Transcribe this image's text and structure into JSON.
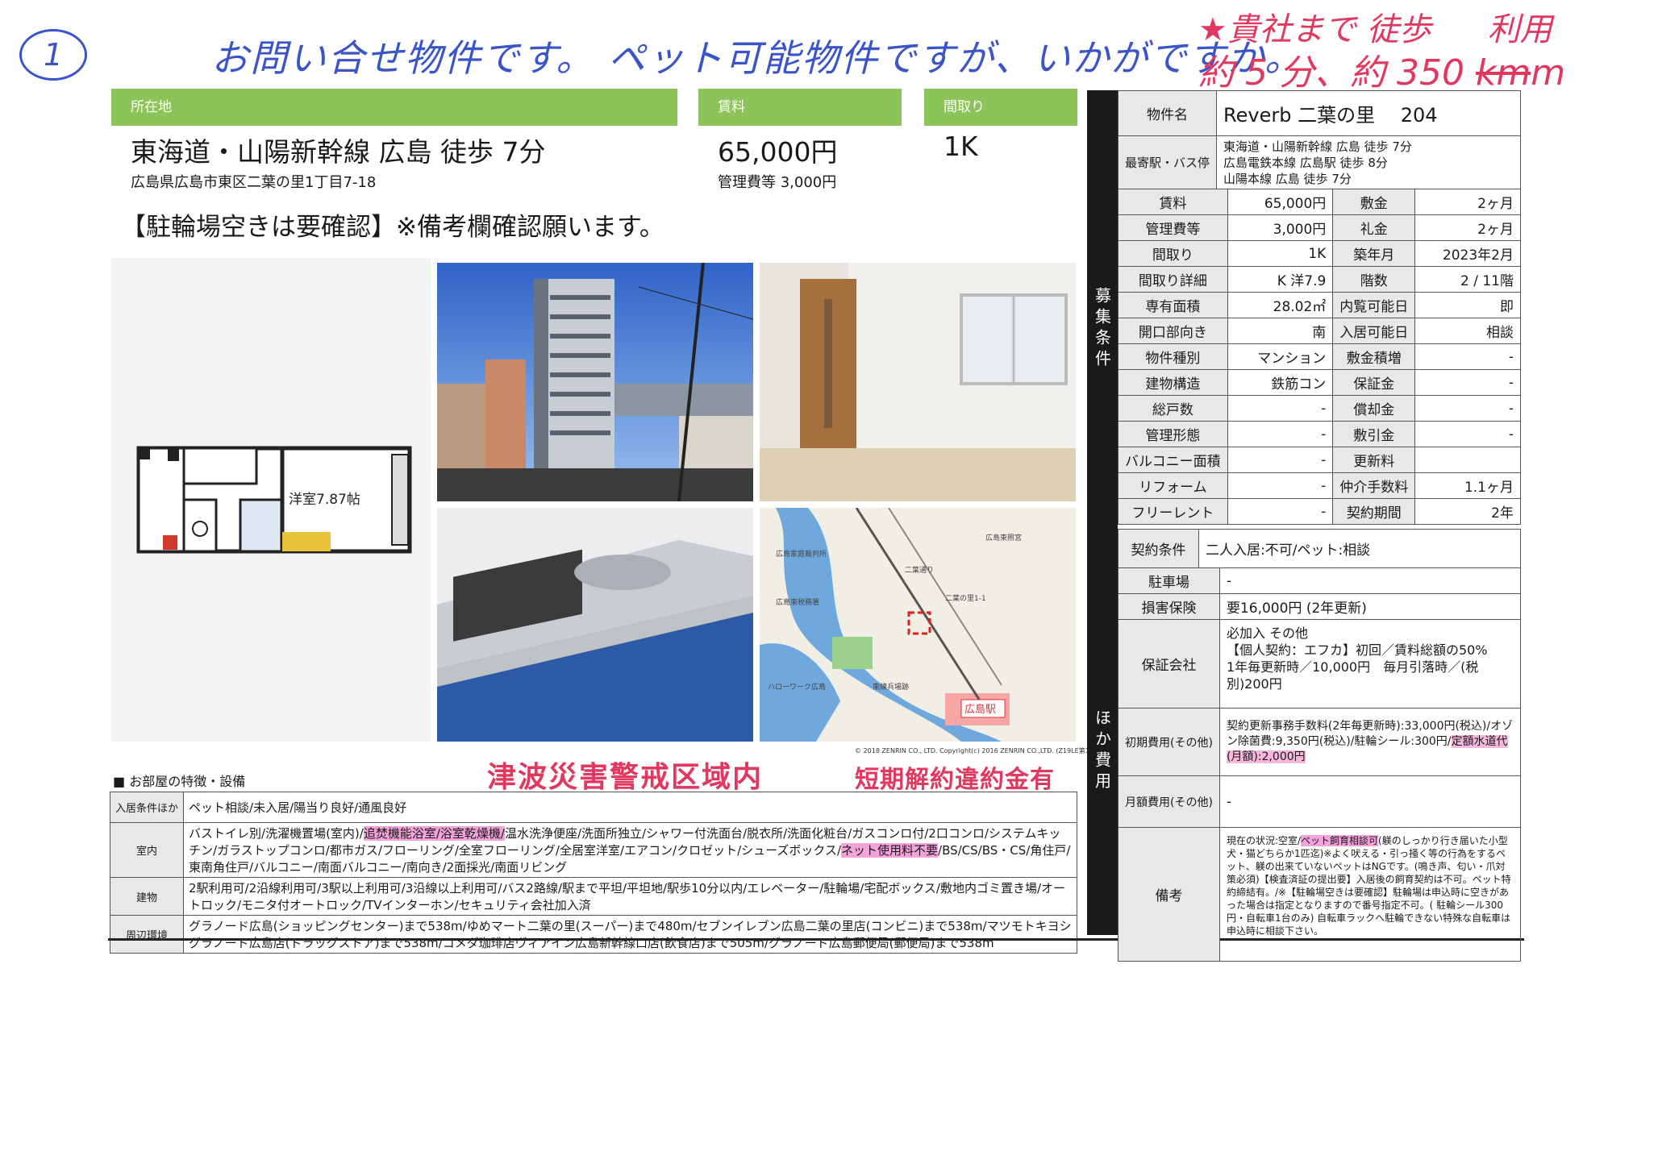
{
  "annotations": {
    "circle_number": "1",
    "blue_note": "お問い合せ物件です。 ペット可能物件ですが、いかがですか。",
    "red_line1_star": "★",
    "red_line1": "貴社まで 徒歩",
    "red_line1_right": "利用",
    "red_line2": "約 5 分、約 350",
    "red_km_struck": "km",
    "red_m": "m",
    "stamp_tsunami": "津波災害警戒区域内",
    "stamp_penalty": "短期解約違約金有"
  },
  "header": {
    "location_label": "所在地",
    "rent_label": "賃料",
    "layout_label": "間取り",
    "station": "東海道・山陽新幹線 広島 徒歩 7分",
    "address": "広島県広島市東区二葉の里1丁目7-18",
    "rent": "65,000円",
    "mgmt_fee": "管理費等 3,000円",
    "layout": "1K",
    "notice": "【駐輪場空きは要確認】※備考欄確認願います。"
  },
  "floorplan": {
    "room_label": "洋室7.87帖"
  },
  "map": {
    "copyright": "© 2018 ZENRIN CO., LTD. Copyright(c) 2016 ZENRIN CO.,LTD. (Z19LE第1442号)",
    "station_label": "広島駅",
    "labels": [
      "広島家庭裁判所",
      "広島東税務署",
      "ハローワーク広島",
      "二葉の里1-1",
      "東練兵場跡",
      "広島東照宮",
      "二葉通り"
    ]
  },
  "spec": {
    "name_label": "物件名",
    "name_value": "Reverb 二葉の里　 204",
    "station_label": "最寄駅・バス停",
    "station_lines": [
      "東海道・山陽新幹線 広島 徒歩 7分",
      "広島電鉄本線 広島駅 徒歩 8分",
      "山陽本線 広島 徒歩 7分"
    ],
    "section_boshu": "募集条件",
    "rows": [
      [
        "賃料",
        "65,000円",
        "敷金",
        "2ヶ月"
      ],
      [
        "管理費等",
        "3,000円",
        "礼金",
        "2ヶ月"
      ],
      [
        "間取り",
        "1K",
        "築年月",
        "2023年2月"
      ],
      [
        "間取り詳細",
        "K 洋7.9",
        "階数",
        "2 / 11階"
      ],
      [
        "専有面積",
        "28.02㎡",
        "内覧可能日",
        "即"
      ],
      [
        "開口部向き",
        "南",
        "入居可能日",
        "相談"
      ],
      [
        "物件種別",
        "マンション",
        "敷金積増",
        "-"
      ],
      [
        "建物構造",
        "鉄筋コン",
        "保証金",
        "-"
      ],
      [
        "総戸数",
        "-",
        "償却金",
        "-"
      ],
      [
        "管理形態",
        "-",
        "敷引金",
        "-"
      ],
      [
        "バルコニー面積",
        "-",
        "更新料",
        ""
      ],
      [
        "リフォーム",
        "-",
        "仲介手数料",
        "1.1ヶ月"
      ],
      [
        "フリーレント",
        "-",
        "契約期間",
        "2年"
      ]
    ],
    "contract_label": "契約条件",
    "contract_value": "二人入居:不可/ペット:相談",
    "section_hoka": "ほか費用",
    "parking_label": "駐車場",
    "parking_value": "-",
    "insurance_label": "損害保険",
    "insurance_value": "要16,000円 (2年更新)",
    "guarantor_label": "保証会社",
    "guarantor_lines": [
      "必加入 その他",
      "【個人契約：エフカ】初回／賃料総額の50%",
      "1年毎更新時／10,000円　毎月引落時／(税別)200円"
    ],
    "initial_label": "初期費用(その他)",
    "initial_text": "契約更新事務手数料(2年毎更新時):33,000円(税込)/オゾン除菌費:9,350円(税込)/駐輪シール:300円/",
    "initial_highlight": "定額水道代(月額):2,000円",
    "monthly_label": "月額費用(その他)",
    "monthly_value": "-",
    "remarks_label": "備考",
    "remarks_pre": "現在の状況:空室/",
    "remarks_hl": "ペット飼育相談可",
    "remarks_post": "(躾のしっかり行き届いた小型犬・猫どちらか1匹迄)※よく吠える・引っ掻く等の行為をするペット、躾の出来ていないペットはNGです。(鳴き声、匂い・爪対策必須)【検査済証の提出要】入居後の飼育契約は不可。ペット特約締結有。/※【駐輪場空きは要確認】駐輪場は申込時に空きがあった場合は指定となりますので番号指定不可。( 駐輪シール300円・自転車1台のみ) 自転車ラックへ駐輪できない特殊な自転車は申込時に相談下さい。"
  },
  "features": {
    "title": "■ お部屋の特徴・設備",
    "rows": [
      {
        "label": "入居条件ほか",
        "text": "ペット相談/未入居/陽当り良好/通風良好"
      },
      {
        "label": "室内",
        "pre": "バストイレ別/洗濯機置場(室内)/",
        "hl1": "追焚機能浴室/浴室乾燥機/",
        "mid": "温水洗浄便座/洗面所独立/シャワー付洗面台/脱衣所/洗面化粧台/ガスコンロ付/2口コンロ/システムキッチン/ガラストップコンロ/都市ガス/フローリング/全室フローリング/全居室洋室/エアコン/クロゼット/シューズボックス/",
        "hl2": "ネット使用料不要",
        "post": "/BS/CS/BS・CS/角住戸/東南角住戸/バルコニー/南面バルコニー/南向き/2面採光/南面リビング"
      },
      {
        "label": "建物",
        "text": "2駅利用可/2沿線利用可/3駅以上利用可/3沿線以上利用可/バス2路線/駅まで平坦/平坦地/駅歩10分以内/エレベーター/駐輪場/宅配ボックス/敷地内ゴミ置き場/オートロック/モニタ付オートロック/TVインターホン/セキュリティ会社加入済"
      },
      {
        "label": "周辺環境",
        "text": "グラノード広島(ショッピングセンター)まで538m/ゆめマート二葉の里(スーパー)まで480m/セブンイレブン広島二葉の里店(コンビニ)まで538m/マツモトキヨシグラノード広島店(ドラッグストア)まで538m/コメダ珈琲店ヴィアイン広島新幹線口店(飲食店)まで505m/グラノード広島郵便局(郵便局)まで538m"
      }
    ]
  }
}
